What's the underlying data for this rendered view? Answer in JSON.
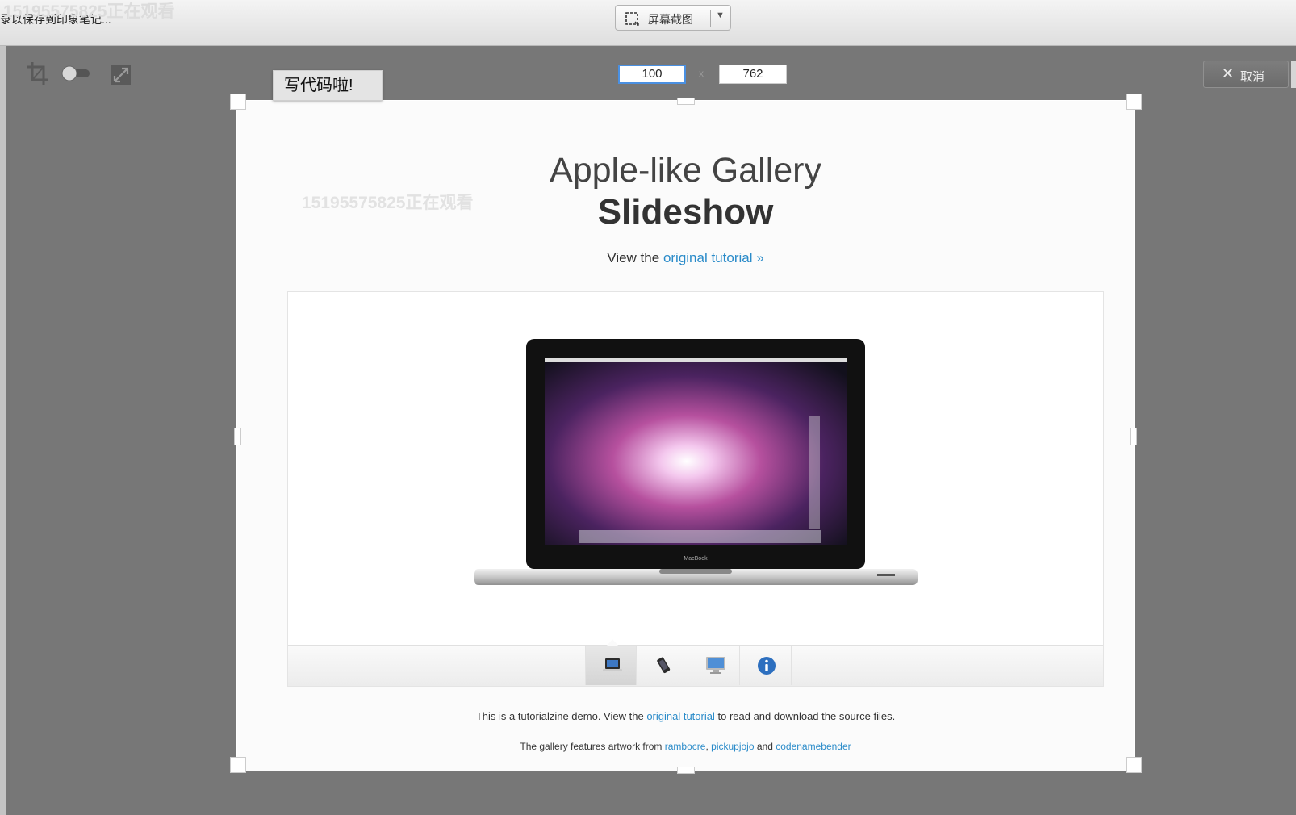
{
  "app": {
    "status_text": "录以保存到印象笔记...",
    "mode_label": "屏幕截图",
    "cancel_label": "取消"
  },
  "dimensions": {
    "width_value": "100",
    "height_value": "762",
    "separator": "x"
  },
  "tooltip": "写代码啦!",
  "watermark": "15195575825正在观看",
  "page": {
    "title_line1": "Apple-like Gallery",
    "title_line2": "Slideshow",
    "sub_prefix": "View the",
    "sub_link": "original tutorial »",
    "footer1_prefix": "This is a tutorialzine demo. View the",
    "footer1_link": "original tutorial",
    "footer1_suffix": "to read and download the source files.",
    "footer2_prefix": "The gallery features artwork from",
    "credit1": "rambocre",
    "credit_sep": ",",
    "credit2": "pickupjojo",
    "credit_and": "and",
    "credit3": "codenamebender"
  },
  "gallery": {
    "laptop_brand": "MacBook",
    "nav_icons": [
      "laptop-icon",
      "phone-icon",
      "monitor-icon",
      "info-icon"
    ],
    "active_index": 0
  },
  "colors": {
    "link": "#2a8bc9",
    "focus": "#4a90e2"
  }
}
